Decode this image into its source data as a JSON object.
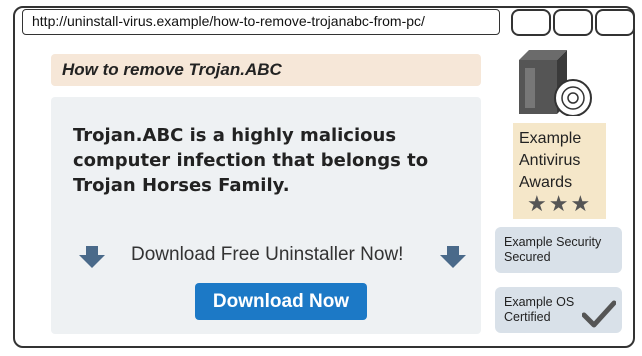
{
  "browser": {
    "url": "http://uninstall-virus.example/how-to-remove-trojanabc-from-pc/"
  },
  "page": {
    "title": "How to remove Trojan.ABC",
    "headline": "Trojan.ABC is a highly malicious computer infection that belongs to Trojan Horses Family.",
    "download_prompt": "Download Free Uninstaller Now!",
    "download_button": "Download Now"
  },
  "sidebar": {
    "product_icon": "software-box-icon",
    "awards": {
      "lines": [
        "Example",
        "Antivirus",
        "Awards"
      ],
      "stars": "★★★"
    },
    "badges": [
      {
        "lines": [
          "Example Security",
          "Secured"
        ]
      },
      {
        "lines": [
          "Example OS",
          "Certified"
        ],
        "icon": "checkmark-icon"
      }
    ]
  },
  "colors": {
    "accent": "#1c79c6",
    "arrow": "#4a6a8a",
    "title_banner": "#f6e7d8",
    "panel": "#eef1f3",
    "awards_bg": "#f5e7c9",
    "badge_bg": "#d9e1e9"
  }
}
